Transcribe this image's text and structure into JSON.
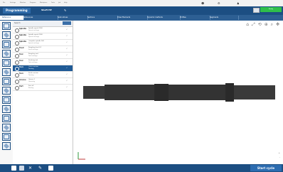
{
  "menu": [
    "File",
    "Settings",
    "Machine",
    "Program",
    "Workpiece",
    "Tools",
    "Job",
    "Help"
  ],
  "toolbar": {
    "mode": "Programming",
    "program": "Shaft HP",
    "status": "Ready"
  },
  "tabs": [
    "Reference",
    "References",
    "Subroutines",
    "Sections",
    "Draw Elements",
    "Dynamic methods",
    "Profiles",
    "Segments"
  ],
  "oplist": {
    "search_placeholder": "Search",
    "rows": [
      {
        "icon": "op-icon",
        "name": "Spindle",
        "sub": "Spindle speed 2000",
        "sub2": "Speed settings"
      },
      {
        "icon": "op-icon",
        "name": "Spindle",
        "sub": "Spindle speed 1000",
        "sub2": "Speed settings"
      },
      {
        "icon": "op-icon",
        "name": "Spindle",
        "sub": "Complete spindle 500",
        "sub2": "Speed settings"
      },
      {
        "icon": "op-icon",
        "name": "Feed",
        "sub": "Roughing feed 0.2",
        "sub2": "Feed settings"
      },
      {
        "icon": "op-icon",
        "name": "Tool",
        "sub": "Roughing tool",
        "sub2": "Tool settings"
      },
      {
        "icon": "op-icon",
        "name": "Tool",
        "sub": "Finishing tool",
        "sub2": "Tool settings"
      },
      {
        "icon": "op-icon",
        "name": "Turn",
        "sub": "Outer contour",
        "sub2": "Turning"
      },
      {
        "icon": "op-icon",
        "name": "Turn",
        "sub": "Finish contour",
        "sub2": "Turning"
      },
      {
        "icon": "op-icon",
        "name": "Groove",
        "sub": "Groove 1",
        "sub2": "Grooving"
      },
      {
        "icon": "op-icon",
        "name": "Part",
        "sub": "Part off",
        "sub2": "Parting"
      }
    ],
    "selected_index": 6
  },
  "view": {
    "zoom_in": "+",
    "zoom_out": "-"
  },
  "bottom": {
    "start_label": "Start cycle"
  }
}
